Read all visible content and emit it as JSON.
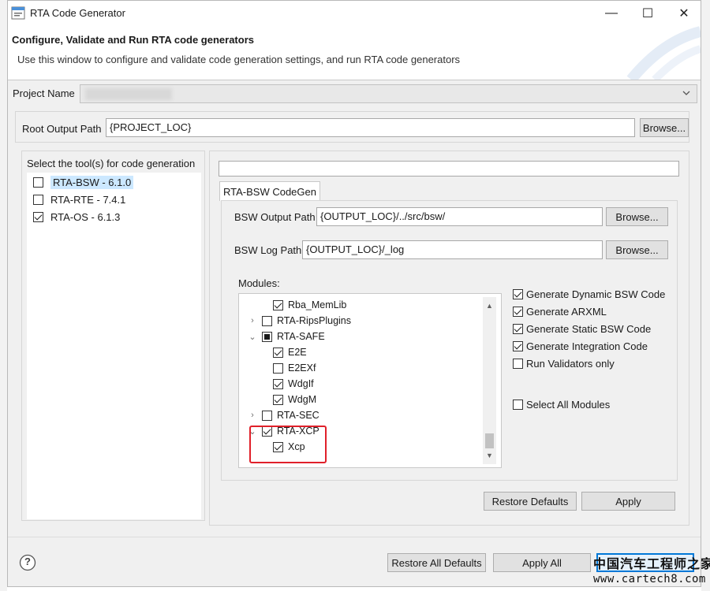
{
  "window": {
    "title": "RTA Code Generator",
    "minimize": "—",
    "maximize": "☐",
    "close": "✕"
  },
  "header": {
    "title": "Configure, Validate and Run RTA code generators",
    "description": "Use this window to configure and validate code generation settings, and run RTA code generators"
  },
  "project": {
    "label": "Project Name",
    "value": ""
  },
  "root_output": {
    "label": "Root Output Path",
    "value": "{PROJECT_LOC}",
    "browse_label": "Browse..."
  },
  "tools": {
    "heading": "Select the tool(s) for code generation",
    "items": [
      {
        "label": "RTA-BSW - 6.1.0",
        "checked": false,
        "selected": true
      },
      {
        "label": "RTA-RTE - 7.4.1",
        "checked": false,
        "selected": false
      },
      {
        "label": "RTA-OS - 6.1.3",
        "checked": true,
        "selected": false
      }
    ]
  },
  "codegen": {
    "filter_value": "",
    "tab_label": "RTA-BSW CodeGen",
    "bsw_output": {
      "label": "BSW Output Path",
      "value": "{OUTPUT_LOC}/../src/bsw/",
      "browse_label": "Browse..."
    },
    "bsw_log": {
      "label": "BSW Log Path",
      "value": "{OUTPUT_LOC}/_log",
      "browse_label": "Browse..."
    },
    "modules_label": "Modules:",
    "modules": [
      {
        "label": "Rba_MemLib",
        "state": "checked",
        "level": 1,
        "expander": ""
      },
      {
        "label": "RTA-RipsPlugins",
        "state": "unchecked",
        "level": 0,
        "expander": "›"
      },
      {
        "label": "RTA-SAFE",
        "state": "partial",
        "level": 0,
        "expander": "⌄"
      },
      {
        "label": "E2E",
        "state": "checked",
        "level": 1,
        "expander": ""
      },
      {
        "label": "E2EXf",
        "state": "unchecked",
        "level": 1,
        "expander": ""
      },
      {
        "label": "WdgIf",
        "state": "checked",
        "level": 1,
        "expander": ""
      },
      {
        "label": "WdgM",
        "state": "checked",
        "level": 1,
        "expander": ""
      },
      {
        "label": "RTA-SEC",
        "state": "unchecked",
        "level": 0,
        "expander": "›"
      },
      {
        "label": "RTA-XCP",
        "state": "checked",
        "level": 0,
        "expander": "⌄"
      },
      {
        "label": "Xcp",
        "state": "checked",
        "level": 1,
        "expander": ""
      }
    ],
    "options": [
      {
        "label": "Generate Dynamic BSW Code",
        "checked": true
      },
      {
        "label": "Generate ARXML",
        "checked": true
      },
      {
        "label": "Generate Static BSW Code",
        "checked": true
      },
      {
        "label": "Generate Integration Code",
        "checked": true
      },
      {
        "label": "Run Validators only",
        "checked": false
      }
    ],
    "select_all": {
      "label": "Select All Modules",
      "checked": false
    },
    "restore_defaults_label": "Restore Defaults",
    "apply_label": "Apply"
  },
  "footer": {
    "help_icon": "?",
    "restore_all_label": "Restore All Defaults",
    "apply_all_label": "Apply All"
  },
  "watermark": {
    "cn": "中国汽车工程师之家",
    "url": "www.cartech8.com"
  },
  "colors": {
    "accent": "#0078d7",
    "selection": "#cce8ff",
    "highlight": "#e0202a"
  }
}
